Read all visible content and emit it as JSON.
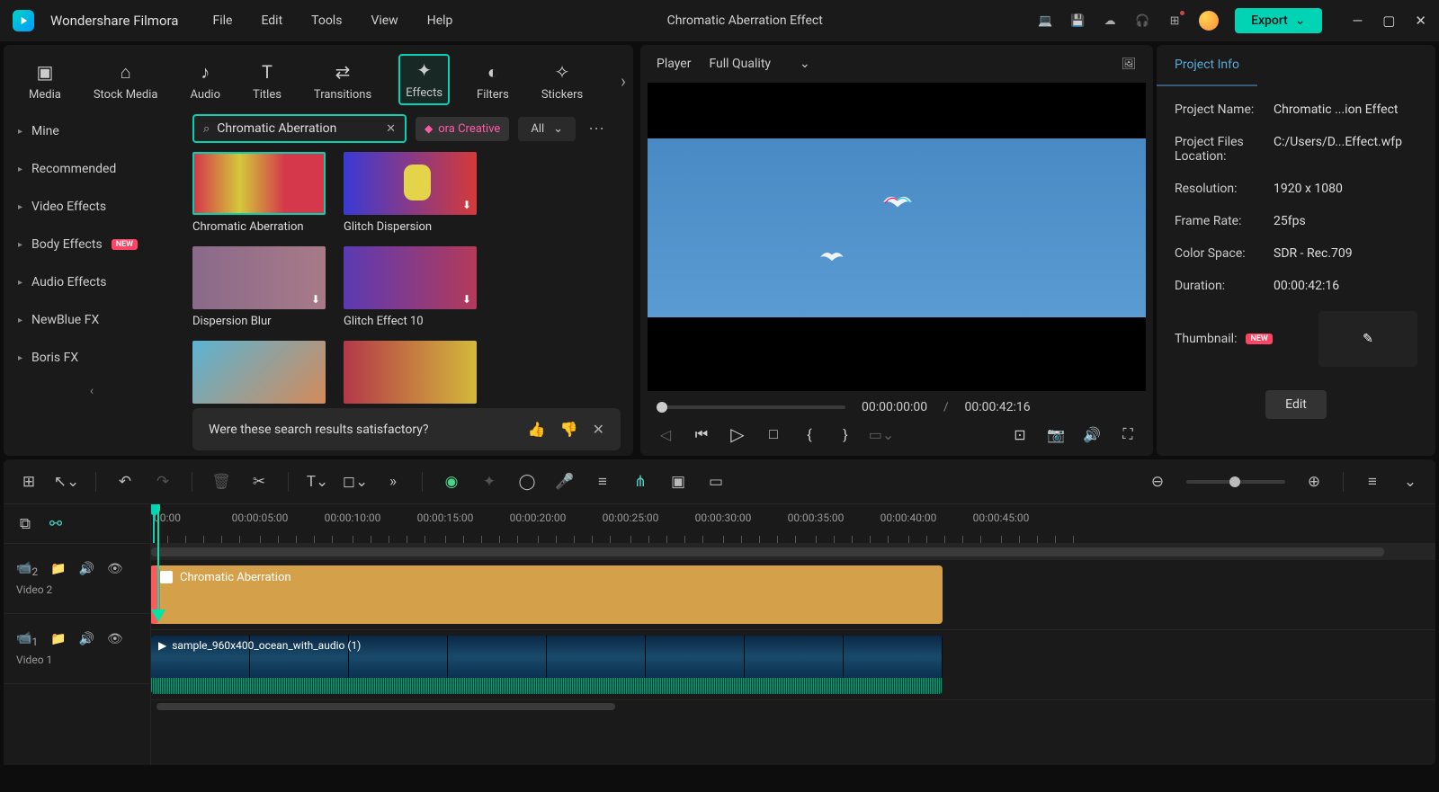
{
  "app": {
    "name": "Wondershare Filmora",
    "document": "Chromatic Aberration Effect"
  },
  "menu": [
    "File",
    "Edit",
    "Tools",
    "View",
    "Help"
  ],
  "export_label": "Export",
  "tabs": [
    {
      "id": "media",
      "label": "Media"
    },
    {
      "id": "stock",
      "label": "Stock Media"
    },
    {
      "id": "audio",
      "label": "Audio"
    },
    {
      "id": "titles",
      "label": "Titles"
    },
    {
      "id": "transitions",
      "label": "Transitions"
    },
    {
      "id": "effects",
      "label": "Effects"
    },
    {
      "id": "filters",
      "label": "Filters"
    },
    {
      "id": "stickers",
      "label": "Stickers"
    }
  ],
  "active_tab": "effects",
  "sidebar": [
    {
      "label": "Mine"
    },
    {
      "label": "Recommended"
    },
    {
      "label": "Video Effects"
    },
    {
      "label": "Body Effects",
      "badge": "NEW"
    },
    {
      "label": "Audio Effects"
    },
    {
      "label": "NewBlue FX"
    },
    {
      "label": "Boris FX"
    }
  ],
  "search": {
    "value": "Chromatic Aberration"
  },
  "creative_pill": "ora Creative",
  "filter_all": "All",
  "effects": [
    {
      "name": "Chromatic Aberration",
      "selected": true
    },
    {
      "name": "Glitch Dispersion",
      "dl": true
    },
    {
      "name": "Dispersion Blur",
      "dl": true
    },
    {
      "name": "Glitch Effect 10",
      "dl": true
    },
    {
      "name": ""
    },
    {
      "name": ""
    }
  ],
  "feedback": {
    "text": "Were these search results satisfactory?"
  },
  "player": {
    "label": "Player",
    "quality": "Full Quality",
    "current": "00:00:00:00",
    "sep": "/",
    "total": "00:00:42:16"
  },
  "project": {
    "tab": "Project Info",
    "rows": [
      {
        "label": "Project Name:",
        "value": "Chromatic ...ion Effect"
      },
      {
        "label": "Project Files Location:",
        "value": "C:/Users/D...Effect.wfp"
      },
      {
        "label": "Resolution:",
        "value": "1920 x 1080"
      },
      {
        "label": "Frame Rate:",
        "value": "25fps"
      },
      {
        "label": "Color Space:",
        "value": "SDR - Rec.709"
      },
      {
        "label": "Duration:",
        "value": "00:00:42:16"
      }
    ],
    "thumb_label": "Thumbnail:",
    "thumb_badge": "NEW",
    "edit": "Edit"
  },
  "timeline": {
    "ruler": [
      "00:00",
      "00:00:05:00",
      "00:00:10:00",
      "00:00:15:00",
      "00:00:20:00",
      "00:00:25:00",
      "00:00:30:00",
      "00:00:35:00",
      "00:00:40:00",
      "00:00:45:00"
    ],
    "tracks": [
      {
        "id": "v2",
        "icon_num": "2",
        "label": "Video 2",
        "clip": {
          "type": "effect",
          "title": "Chromatic Aberration"
        }
      },
      {
        "id": "v1",
        "icon_num": "1",
        "label": "Video 1",
        "clip": {
          "type": "video",
          "title": "sample_960x400_ocean_with_audio (1)"
        }
      }
    ]
  }
}
